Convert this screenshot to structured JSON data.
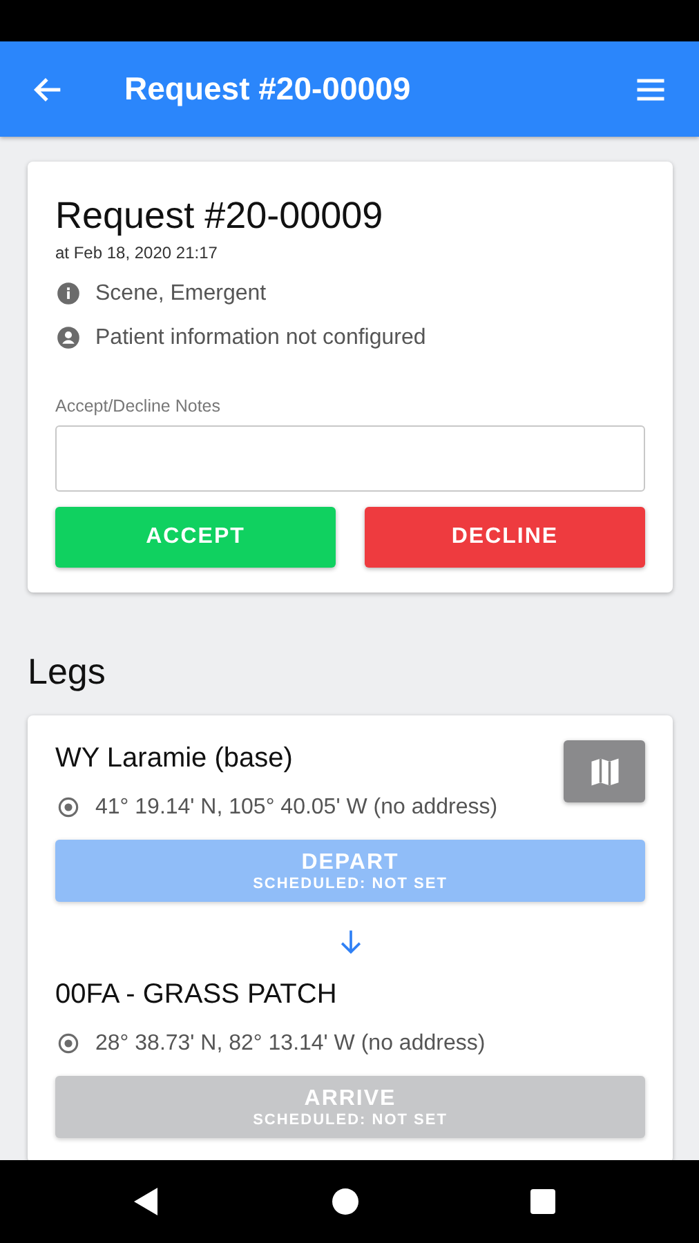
{
  "app_bar": {
    "title": "Request #20-00009"
  },
  "request": {
    "title": "Request #20-00009",
    "time": "at Feb 18, 2020 21:17",
    "details": [
      {
        "kind": "info",
        "text": "Scene, Emergent"
      },
      {
        "kind": "person",
        "text": "Patient information not configured"
      }
    ],
    "notes": {
      "label": "Accept/Decline Notes"
    },
    "buttons": [
      {
        "kind": "accept",
        "label": "ACCEPT"
      },
      {
        "kind": "decline",
        "label": "DECLINE"
      }
    ]
  },
  "legs": {
    "heading": "Legs",
    "stops": [
      {
        "name": "WY Laramie (base)",
        "location": "41° 19.14' N, 105° 40.05' W (no address)",
        "has_map": true,
        "action": {
          "kind": "depart",
          "label": "DEPART",
          "sub": "SCHEDULED: NOT SET"
        }
      },
      {
        "name": "00FA - GRASS PATCH",
        "location": "28° 38.73' N, 82° 13.14' W (no address)",
        "has_map": false,
        "action": {
          "kind": "arrive",
          "label": "ARRIVE",
          "sub": "SCHEDULED: NOT SET"
        }
      }
    ]
  }
}
